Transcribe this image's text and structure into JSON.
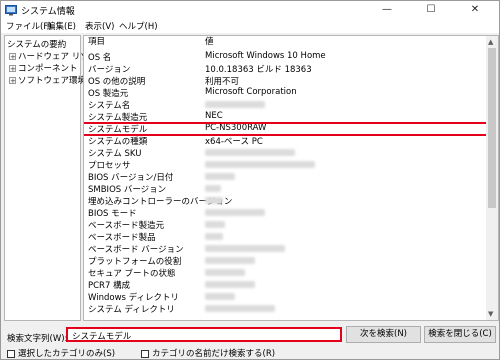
{
  "window": {
    "title": "システム情報",
    "minimize": "—",
    "maximize": "☐",
    "close": "✕"
  },
  "menu": [
    "ファイル(F)",
    "編集(E)",
    "表示(V)",
    "ヘルプ(H)"
  ],
  "tree": {
    "root": "システムの要約",
    "children": [
      "ハードウェア リソース",
      "コンポーネント",
      "ソフトウェア環境"
    ]
  },
  "columns": {
    "item": "項目",
    "value": "値"
  },
  "rows": [
    {
      "item": "OS 名",
      "value": "Microsoft Windows 10 Home"
    },
    {
      "item": "バージョン",
      "value": "10.0.18363 ビルド 18363"
    },
    {
      "item": "OS の他の説明",
      "value": "利用不可"
    },
    {
      "item": "OS 製造元",
      "value": "Microsoft Corporation"
    },
    {
      "item": "システム名",
      "value": ""
    },
    {
      "item": "システム製造元",
      "value": "NEC"
    },
    {
      "item": "システムモデル",
      "value": "PC-NS300RAW"
    },
    {
      "item": "システムの種類",
      "value": "x64-ベース PC"
    },
    {
      "item": "システム SKU",
      "value": ""
    },
    {
      "item": "プロセッサ",
      "value": ""
    },
    {
      "item": "BIOS バージョン/日付",
      "value": ""
    },
    {
      "item": "SMBIOS バージョン",
      "value": ""
    },
    {
      "item": "埋め込みコントローラーのバージョン",
      "value": ""
    },
    {
      "item": "BIOS モード",
      "value": ""
    },
    {
      "item": "ベースボード製造元",
      "value": ""
    },
    {
      "item": "ベースボード製品",
      "value": ""
    },
    {
      "item": "ベースボード バージョン",
      "value": ""
    },
    {
      "item": "プラットフォームの役割",
      "value": ""
    },
    {
      "item": "セキュア ブートの状態",
      "value": ""
    },
    {
      "item": "PCR7 構成",
      "value": ""
    },
    {
      "item": "Windows ディレクトリ",
      "value": ""
    },
    {
      "item": "システム ディレクトリ",
      "value": ""
    }
  ],
  "search": {
    "label": "検索文字列(W):",
    "value": "システムモデル",
    "find_next": "次を検索(N)",
    "close_find": "検索を閉じる(C)",
    "only_selected": "選択したカテゴリのみ(S)",
    "names_only": "カテゴリの名前だけ検索する(R)"
  },
  "colors": {
    "highlight": "#e3001b"
  }
}
